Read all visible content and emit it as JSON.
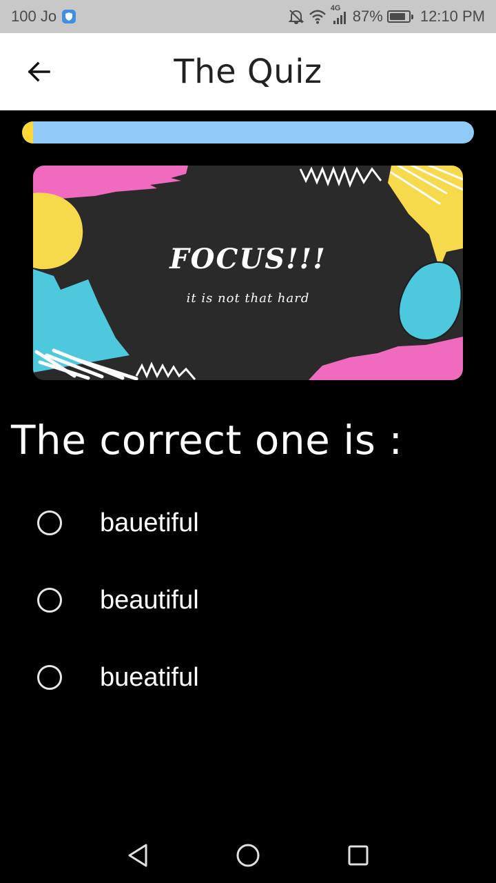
{
  "status_bar": {
    "carrier_text": "100 Jo",
    "network_type": "4G",
    "battery_percent": "87%",
    "battery_level": 0.87,
    "time": "12:10 PM",
    "icons": [
      "shield-icon",
      "mute-icon",
      "wifi-icon",
      "signal-icon",
      "battery-icon"
    ]
  },
  "app_bar": {
    "title": "The Quiz",
    "back_icon": "arrow-left-icon"
  },
  "progress": {
    "value": 0.025,
    "track_color": "#90caf9",
    "fill_color": "#fdd835"
  },
  "banner": {
    "title": "FOCUS!!!",
    "subtitle": "it is not that hard",
    "colors": {
      "background": "#2a2a2a",
      "pink": "#f06bbf",
      "yellow": "#f7d94c",
      "cyan": "#4ec8dc",
      "white": "#ffffff"
    }
  },
  "question": {
    "text": "The correct one is :"
  },
  "options": [
    {
      "label": "bauetiful",
      "selected": false
    },
    {
      "label": "beautiful",
      "selected": false
    },
    {
      "label": "bueatiful",
      "selected": false
    }
  ],
  "nav_bar": {
    "icons": [
      "back-triangle-icon",
      "home-circle-icon",
      "recents-square-icon"
    ]
  }
}
